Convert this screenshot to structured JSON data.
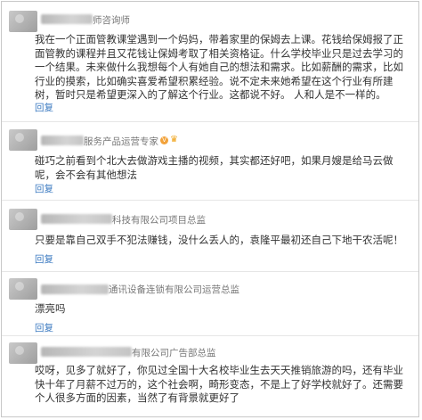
{
  "reply_label": "回复",
  "comments": [
    {
      "title": "师咨询师",
      "text": "我在一个正面管教课堂遇到一个妈妈，带着家里的保姆去上课。花钱给保姆报了正面管教的课程并且又花钱让保姆考取了相关资格证。什么学校毕业只是过去学习的一个结果。未来做什么我想每个人有她自己的想法和需求。比如薪酬的需求，比如行业的摸索，比如确实喜爱希望积累经验。说不定未来她希望在这个行业有所建树，暂时只是希望更深入的了解这个行业。这都说不好。 人和人是不一样的。"
    },
    {
      "title": "服务产品运营专家",
      "vip": "V",
      "crown": "♛",
      "text": "碰巧之前看到个北大去做游戏主播的视频，其实都还好吧，如果月嫂是给马云做呢，会不会有其他想法"
    },
    {
      "title": "科技有限公司项目总监",
      "text": "只要是靠自己双手不犯法赚钱，没什么丢人的，袁隆平最初还自己下地干农活呢！"
    },
    {
      "title": "通讯设备连锁有限公司运营总监",
      "text": "漂亮吗"
    },
    {
      "title": "有限公司广告部总监",
      "text": "哎呀，见多了就好了，你见过全国十大名校毕业生去天天推销旅游的吗，还有毕业快十年了月薪不过万的，这个社会啊，畸形变态，不是上了好学校就好了。还需要个人很多方面的因素，当然了有背景就更好了"
    }
  ]
}
